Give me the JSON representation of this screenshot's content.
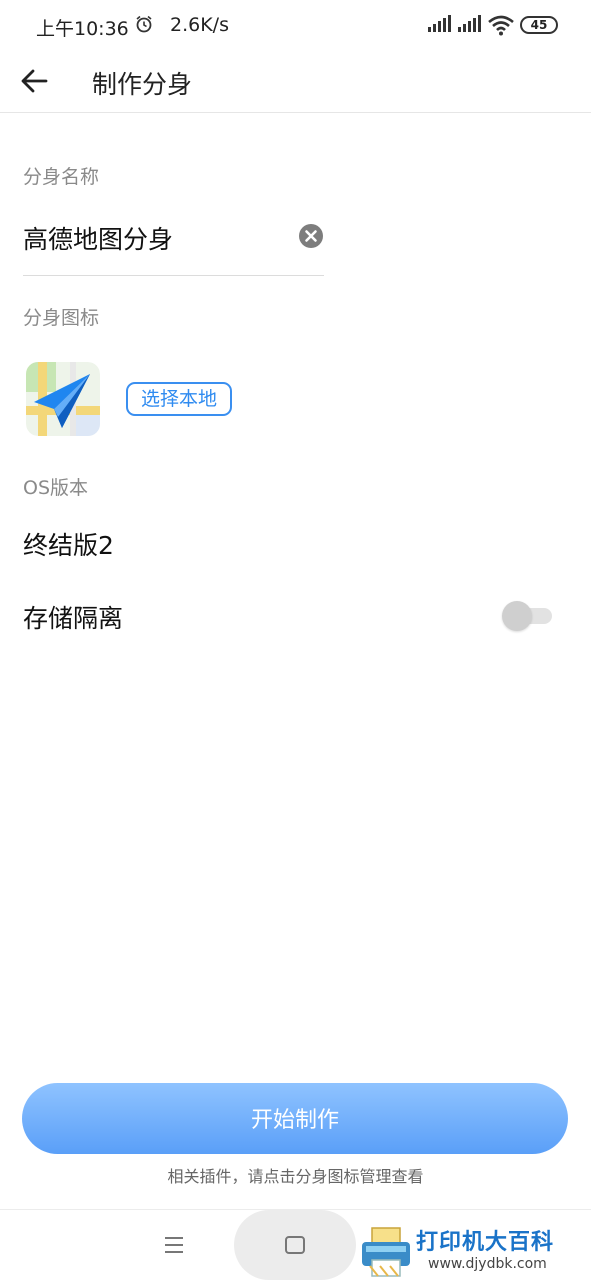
{
  "status_bar": {
    "time": "上午10:36",
    "net_speed": "2.6K/s",
    "battery": "45",
    "icons": [
      "alarm-icon",
      "signal-icon",
      "signal-icon",
      "wifi-icon",
      "battery-icon"
    ]
  },
  "app_bar": {
    "title": "制作分身",
    "back_icon": "arrow-left-icon"
  },
  "form": {
    "name_label": "分身名称",
    "name_value": "高德地图分身",
    "icon_label": "分身图标",
    "choose_local": "选择本地",
    "os_label": "OS版本",
    "os_value": "终结版2",
    "isolation_label": "存储隔离",
    "isolation_enabled": false
  },
  "colors": {
    "accent": "#2f8bf0",
    "button_gradient_top": "#8fc3ff",
    "button_gradient_bottom": "#5a9ff8"
  },
  "footer": {
    "start_button": "开始制作",
    "hint": "相关插件，请点击分身图标管理查看"
  },
  "watermark": {
    "text": "打印机大百科",
    "url": "www.djydbk.com"
  }
}
